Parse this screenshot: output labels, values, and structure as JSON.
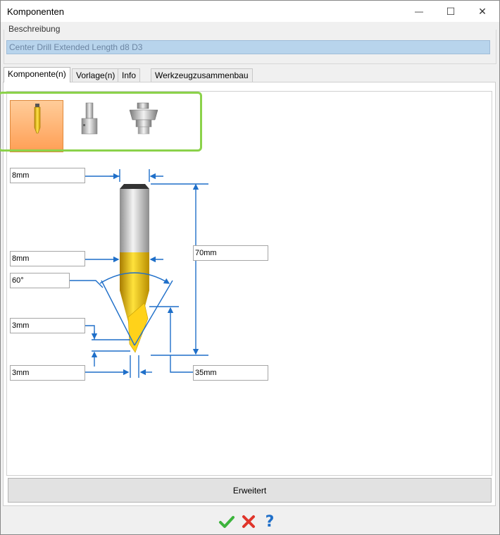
{
  "window": {
    "title": "Komponenten",
    "minimize_glyph": "—",
    "maximize_glyph": "☐",
    "close_glyph": "✕"
  },
  "description": {
    "label": "Beschreibung",
    "value": "Center Drill Extended Length d8 D3"
  },
  "tabs": [
    {
      "label": "Komponente(n)",
      "active": true
    },
    {
      "label": "Vorlage(n)",
      "active": false
    },
    {
      "label": "Info",
      "active": false
    },
    {
      "label": "Werkzeugzusammenbau",
      "active": false
    }
  ],
  "components": [
    {
      "icon": "drill-icon",
      "selected": true
    },
    {
      "icon": "holder-icon",
      "selected": false
    },
    {
      "icon": "spindle-adapter-icon",
      "selected": false
    }
  ],
  "dimensions": {
    "top_diameter": "8mm",
    "shank_diameter": "8mm",
    "angle": "60°",
    "tip_length": "3mm",
    "tip_diameter": "3mm",
    "total_length": "70mm",
    "cutting_length": "35mm"
  },
  "advanced_button": "Erweitert",
  "actions": {
    "ok_icon": "checkmark-icon",
    "cancel_icon": "cross-icon",
    "help_label": "?"
  },
  "colors": {
    "accent_blue": "#1f6fc9",
    "selected_tile": "#ffb070",
    "highlight_green": "#8bd24a",
    "drill_gold": "#e8b800"
  }
}
